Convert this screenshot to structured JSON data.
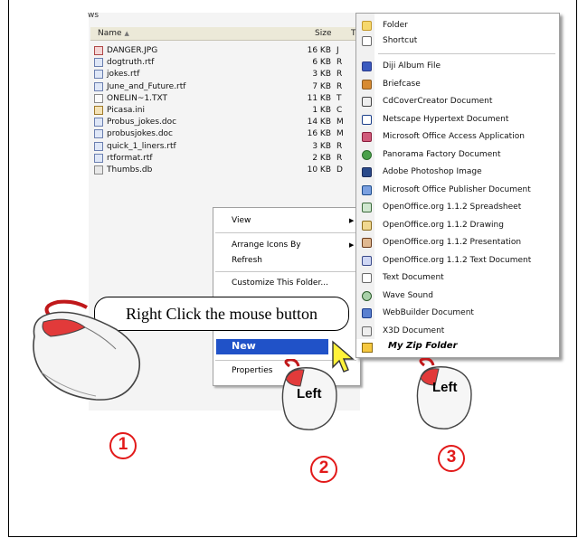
{
  "window": {
    "title_fragment": "ws"
  },
  "header": {
    "name": "Name",
    "sort_indicator": "▲",
    "size": "Size",
    "type": "T"
  },
  "files": [
    {
      "name": "DANGER.JPG",
      "size": "16 KB",
      "type": "J",
      "icon": "image-file-icon"
    },
    {
      "name": "dogtruth.rtf",
      "size": "6 KB",
      "type": "R",
      "icon": "rtf-file-icon"
    },
    {
      "name": "jokes.rtf",
      "size": "3 KB",
      "type": "R",
      "icon": "rtf-file-icon"
    },
    {
      "name": "June_and_Future.rtf",
      "size": "7 KB",
      "type": "R",
      "icon": "rtf-file-icon"
    },
    {
      "name": "ONELIN~1.TXT",
      "size": "11 KB",
      "type": "T",
      "icon": "text-file-icon"
    },
    {
      "name": "Picasa.ini",
      "size": "1 KB",
      "type": "C",
      "icon": "ini-file-icon"
    },
    {
      "name": "Probus_jokes.doc",
      "size": "14 KB",
      "type": "M",
      "icon": "doc-file-icon"
    },
    {
      "name": "probusjokes.doc",
      "size": "16 KB",
      "type": "M",
      "icon": "doc-file-icon"
    },
    {
      "name": "quick_1_liners.rtf",
      "size": "3 KB",
      "type": "R",
      "icon": "rtf-file-icon"
    },
    {
      "name": "rtformat.rtf",
      "size": "2 KB",
      "type": "R",
      "icon": "rtf-file-icon"
    },
    {
      "name": "Thumbs.db",
      "size": "10 KB",
      "type": "D",
      "icon": "db-file-icon"
    }
  ],
  "context_menu": {
    "view": "View",
    "arrange": "Arrange Icons By",
    "refresh": "Refresh",
    "customize": "Customize This Folder...",
    "new": "New",
    "properties": "Properties"
  },
  "submenu": {
    "items": [
      {
        "label": "Folder",
        "icon": "folder-icon"
      },
      {
        "label": "Shortcut",
        "icon": "shortcut-icon"
      },
      {
        "label": "Diji Album File",
        "icon": "diji-album-icon"
      },
      {
        "label": "Briefcase",
        "icon": "briefcase-icon"
      },
      {
        "label": "CdCoverCreator Document",
        "icon": "cdcover-icon"
      },
      {
        "label": "Netscape Hypertext Document",
        "icon": "netscape-icon"
      },
      {
        "label": "Microsoft Office Access Application",
        "icon": "access-icon"
      },
      {
        "label": "Panorama Factory Document",
        "icon": "panorama-icon"
      },
      {
        "label": "Adobe Photoshop Image",
        "icon": "photoshop-icon"
      },
      {
        "label": "Microsoft Office Publisher Document",
        "icon": "publisher-icon"
      },
      {
        "label": "OpenOffice.org 1.1.2 Spreadsheet",
        "icon": "oo-spreadsheet-icon"
      },
      {
        "label": "OpenOffice.org 1.1.2 Drawing",
        "icon": "oo-drawing-icon"
      },
      {
        "label": "OpenOffice.org 1.1.2 Presentation",
        "icon": "oo-presentation-icon"
      },
      {
        "label": "OpenOffice.org 1.1.2 Text Document",
        "icon": "oo-text-icon"
      },
      {
        "label": "Text Document",
        "icon": "text-document-icon"
      },
      {
        "label": "Wave Sound",
        "icon": "wave-sound-icon"
      },
      {
        "label": "WebBuilder Document",
        "icon": "webbuilder-icon"
      },
      {
        "label": "X3D Document",
        "icon": "x3d-icon"
      }
    ],
    "zip": "My Zip Folder"
  },
  "callout": {
    "text": "Right Click the mouse button"
  },
  "steps": {
    "one": "1",
    "two": "2",
    "three": "3",
    "left_label": "Left"
  },
  "colors": {
    "highlight": "#2052c8",
    "step_red": "#e21a1a"
  }
}
